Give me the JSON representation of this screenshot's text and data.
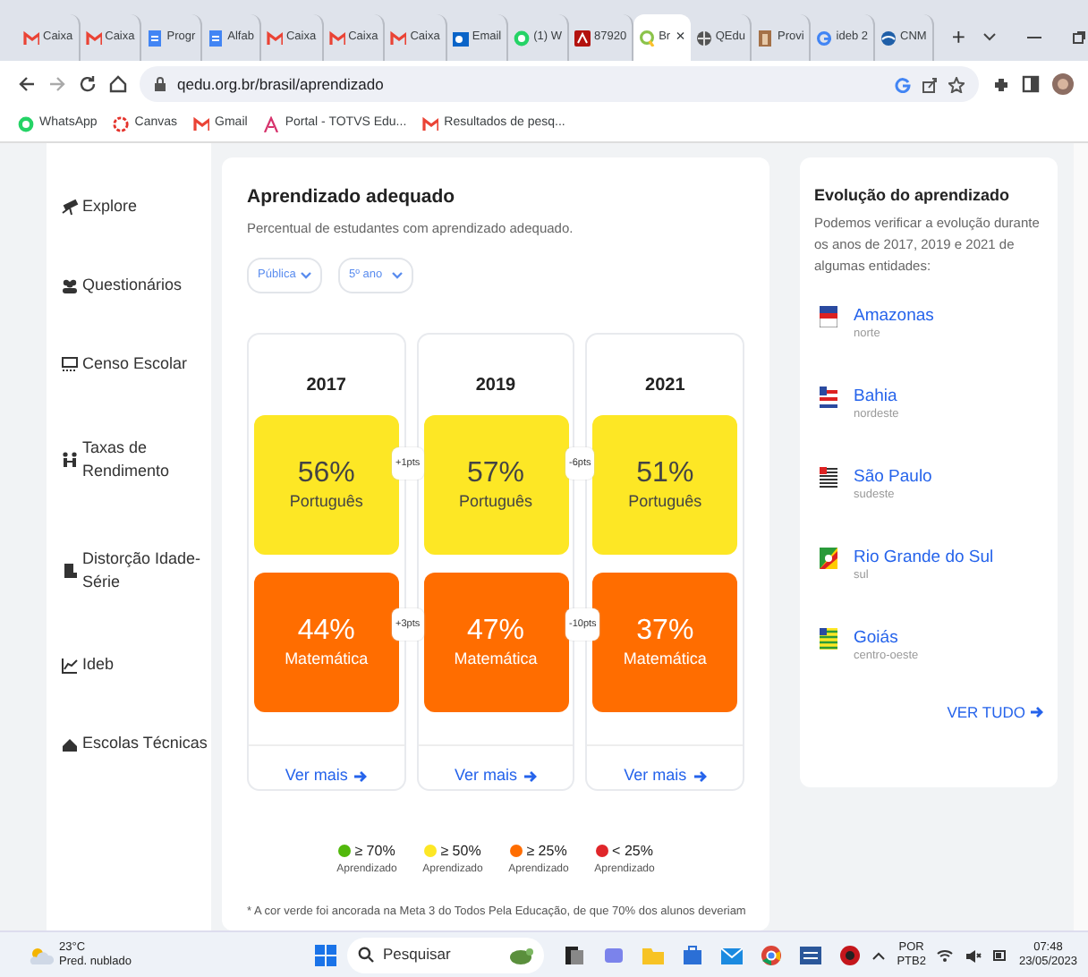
{
  "browser": {
    "tabs": [
      {
        "label": "Caixa",
        "kind": "gmail",
        "selected": false
      },
      {
        "label": "Caixa",
        "kind": "gmail",
        "selected": false
      },
      {
        "label": "Progr",
        "kind": "doc",
        "selected": false
      },
      {
        "label": "Alfab",
        "kind": "doc",
        "selected": false
      },
      {
        "label": "Caixa",
        "kind": "gmail",
        "selected": false
      },
      {
        "label": "Caixa",
        "kind": "gmail",
        "selected": false
      },
      {
        "label": "Caixa",
        "kind": "gmail",
        "selected": false
      },
      {
        "label": "Email",
        "kind": "outlook",
        "selected": false
      },
      {
        "label": "(1) W",
        "kind": "whatsapp",
        "selected": false
      },
      {
        "label": "87920",
        "kind": "pdf",
        "selected": false
      },
      {
        "label": "Br",
        "kind": "qedu",
        "selected": true,
        "close": "×"
      },
      {
        "label": "QEdu",
        "kind": "globe",
        "selected": false
      },
      {
        "label": "Provi",
        "kind": "photo",
        "selected": false
      },
      {
        "label": "ideb 2",
        "kind": "google",
        "selected": false
      },
      {
        "label": "CNM",
        "kind": "cnm",
        "selected": false
      }
    ],
    "new_tab": "+",
    "url": "qedu.org.br/brasil/aprendizado",
    "bookmarks": [
      {
        "label": "WhatsApp",
        "kind": "whatsapp"
      },
      {
        "label": "Canvas",
        "kind": "canvas"
      },
      {
        "label": "Gmail",
        "kind": "gmail"
      },
      {
        "label": "Portal - TOTVS Edu...",
        "kind": "totvs"
      },
      {
        "label": "Resultados de pesq...",
        "kind": "gmail"
      }
    ]
  },
  "sidebar": {
    "items": [
      {
        "label": "Explore",
        "kind": "telescope"
      },
      {
        "label": "Questionários",
        "kind": "people"
      },
      {
        "label": "Censo Escolar",
        "kind": "school"
      },
      {
        "label": "Taxas de Rendimento",
        "kind": "exchange"
      },
      {
        "label": "Distorção Idade-Série",
        "kind": "door"
      },
      {
        "label": "Ideb",
        "kind": "chart"
      },
      {
        "label": "Escolas Técnicas",
        "kind": "building"
      }
    ]
  },
  "main": {
    "title": "Aprendizado adequado",
    "subtitle": "Percentual de estudantes com aprendizado adequado.",
    "filters": [
      {
        "value": "Pública"
      },
      {
        "value": "5º ano"
      }
    ],
    "years": [
      {
        "year": "2017",
        "cells": [
          {
            "value": "56%",
            "subject": "Português",
            "color": "#fde725"
          },
          {
            "value": "44%",
            "subject": "Matemática",
            "color": "#ff6d00"
          }
        ],
        "link": "Ver mais"
      },
      {
        "year": "2019",
        "cells": [
          {
            "value": "57%",
            "subject": "Português",
            "color": "#fde725"
          },
          {
            "value": "47%",
            "subject": "Matemática",
            "color": "#ff6d00"
          }
        ],
        "link": "Ver mais"
      },
      {
        "year": "2021",
        "cells": [
          {
            "value": "51%",
            "subject": "Português",
            "color": "#fde725"
          },
          {
            "value": "37%",
            "subject": "Matemática",
            "color": "#ff6d00"
          }
        ],
        "link": "Ver mais"
      }
    ],
    "changes": [
      [
        "+1pts",
        "-6pts"
      ],
      [
        "+3pts",
        "-10pts"
      ]
    ],
    "legend": [
      {
        "color": "#52b80c",
        "label": "≥ 70%",
        "caption": "Aprendizado"
      },
      {
        "color": "#fde725",
        "label": "≥ 50%",
        "caption": "Aprendizado"
      },
      {
        "color": "#ff6d00",
        "label": "≥ 25%",
        "caption": "Aprendizado"
      },
      {
        "color": "#e0262a",
        "label": "< 25%",
        "caption": "Aprendizado"
      }
    ],
    "footnote": "* A cor verde foi ancorada na Meta 3 do Todos Pela Educação, de que 70% dos alunos deveriam"
  },
  "evolution": {
    "title": "Evolução do aprendizado",
    "text": "Podemos verificar a evolução durante os anos de 2017, 2019 e 2021 de algumas entidades:",
    "states": [
      {
        "name": "Amazonas",
        "region": "norte",
        "kind": "amazonas"
      },
      {
        "name": "Bahia",
        "region": "nordeste",
        "kind": "bahia"
      },
      {
        "name": "São Paulo",
        "region": "sudeste",
        "kind": "saopaulo"
      },
      {
        "name": "Rio Grande do Sul",
        "region": "sul",
        "kind": "rs"
      },
      {
        "name": "Goiás",
        "region": "centro-oeste",
        "kind": "goias"
      }
    ],
    "link": "VER TUDO"
  },
  "taskbar": {
    "temperature": "23°C",
    "weather": "Pred. nublado",
    "search_placeholder": "Pesquisar",
    "language": "POR",
    "layout": "PTB2",
    "time": "07:48",
    "date": "23/05/2023"
  }
}
